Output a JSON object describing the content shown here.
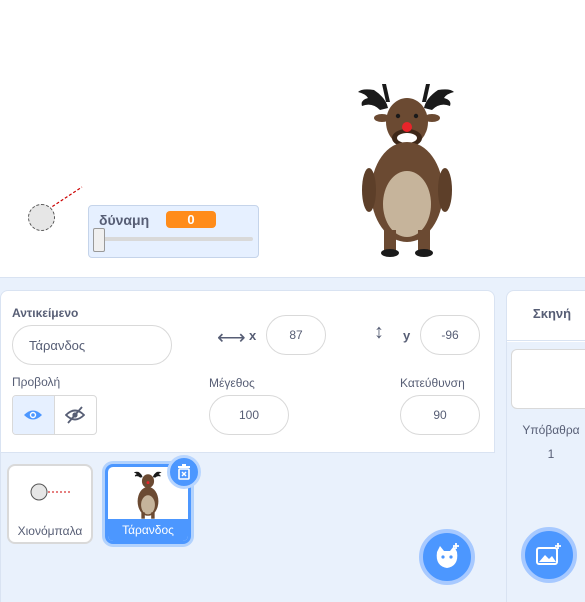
{
  "stage": {
    "monitor": {
      "label": "δύναμη",
      "value": "0",
      "slider_level": 0
    }
  },
  "sprite_info": {
    "sprite_label": "Αντικείμενο",
    "sprite_name": "Τάρανδος",
    "x_label": "x",
    "x_value": "87",
    "y_label": "y",
    "y_value": "-96",
    "show_label": "Προβολή",
    "size_label": "Μέγεθος",
    "size_value": "100",
    "direction_label": "Κατεύθυνση",
    "direction_value": "90"
  },
  "sprites": [
    {
      "name": "Χιονόμπαλα",
      "selected": false
    },
    {
      "name": "Τάρανδος",
      "selected": true
    }
  ],
  "stage_panel": {
    "title": "Σκηνή",
    "backdrops_label": "Υπόβαθρα",
    "backdrops_count": "1"
  },
  "colors": {
    "accent": "#4c97ff",
    "monitor_value": "#ff8c1a"
  },
  "icons": [
    "horizontal-arrow-icon",
    "vertical-arrow-icon",
    "eye-icon",
    "eye-slash-icon",
    "trash-icon",
    "add-sprite-icon",
    "add-backdrop-icon"
  ]
}
